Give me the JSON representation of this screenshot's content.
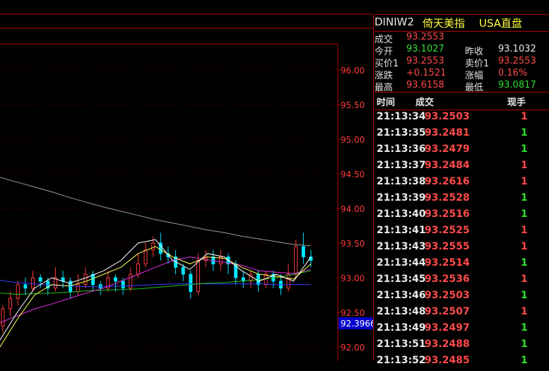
{
  "header": {
    "code": "DINIW2",
    "name": "倚天美指",
    "type": "USA直盘"
  },
  "quote": {
    "rows": [
      {
        "l1": "成交",
        "v1": "93.2553",
        "c1": "red"
      },
      {
        "l1": "今开",
        "v1": "93.1027",
        "c1": "green",
        "l2": "昨收",
        "v2": "93.1032",
        "c2": "white"
      },
      {
        "l1": "买价1",
        "v1": "93.2553",
        "c1": "red",
        "l2": "卖价1",
        "v2": "93.2553",
        "c2": "red"
      },
      {
        "l1": "涨跌",
        "v1": "+0.1521",
        "c1": "red",
        "l2": "涨幅",
        "v2": "0.16%",
        "c2": "red"
      },
      {
        "l1": "最高",
        "v1": "93.6158",
        "c1": "red",
        "l2": "最低",
        "v2": "93.0817",
        "c2": "green"
      }
    ]
  },
  "ticks": {
    "col_time": "时间",
    "col_price": "成交",
    "col_vol": "现手",
    "rows": [
      {
        "time": "21:13:34",
        "price": "93.2503",
        "vol": "1",
        "vc": "red"
      },
      {
        "time": "21:13:35",
        "price": "93.2481",
        "vol": "1",
        "vc": "green"
      },
      {
        "time": "21:13:36",
        "price": "93.2479",
        "vol": "1",
        "vc": "green"
      },
      {
        "time": "21:13:37",
        "price": "93.2484",
        "vol": "1",
        "vc": "red"
      },
      {
        "time": "21:13:38",
        "price": "93.2616",
        "vol": "1",
        "vc": "red"
      },
      {
        "time": "21:13:39",
        "price": "93.2528",
        "vol": "1",
        "vc": "green"
      },
      {
        "time": "21:13:40",
        "price": "93.2516",
        "vol": "1",
        "vc": "green"
      },
      {
        "time": "21:13:41",
        "price": "93.2525",
        "vol": "1",
        "vc": "red"
      },
      {
        "time": "21:13:43",
        "price": "93.2555",
        "vol": "1",
        "vc": "red"
      },
      {
        "time": "21:13:44",
        "price": "93.2514",
        "vol": "1",
        "vc": "green"
      },
      {
        "time": "21:13:45",
        "price": "93.2536",
        "vol": "1",
        "vc": "red"
      },
      {
        "time": "21:13:46",
        "price": "93.2503",
        "vol": "1",
        "vc": "green"
      },
      {
        "time": "21:13:48",
        "price": "93.2507",
        "vol": "1",
        "vc": "red"
      },
      {
        "time": "21:13:49",
        "price": "93.2497",
        "vol": "1",
        "vc": "green"
      },
      {
        "time": "21:13:51",
        "price": "93.2488",
        "vol": "1",
        "vc": "green"
      },
      {
        "time": "21:13:52",
        "price": "93.2485",
        "vol": "1",
        "vc": "green"
      }
    ]
  },
  "chart_data": {
    "type": "line",
    "y_ticks": [
      "96.00",
      "95.50",
      "95.00",
      "94.50",
      "94.00",
      "93.50",
      "93.00",
      "92.50",
      "92.00"
    ],
    "ylim": [
      92.0,
      96.0
    ],
    "current_price_label": "92.3966",
    "series": [
      {
        "values": [
          94.45,
          94.38,
          94.31,
          94.24,
          94.16,
          94.09,
          94.02,
          93.96,
          93.9,
          93.84,
          93.79,
          93.74,
          93.69,
          93.65,
          93.6,
          93.56,
          93.52,
          93.48,
          93.46
        ],
        "color": "#9a9a9a"
      },
      {
        "values": [
          92.96,
          92.93,
          92.91,
          92.89,
          92.88,
          92.87,
          92.87,
          92.88,
          92.89,
          92.9,
          92.91,
          92.91,
          92.91,
          92.91,
          92.91,
          92.91,
          92.9,
          92.9,
          92.9
        ],
        "color": "#3a3aff"
      },
      {
        "values": [
          92.78,
          92.76,
          92.77,
          92.78,
          92.79,
          92.81,
          92.82,
          92.83,
          92.84,
          92.86,
          92.88,
          92.9,
          92.92,
          92.93,
          92.95,
          92.97,
          93.0,
          93.05,
          93.1
        ],
        "color": "#20c020"
      },
      {
        "values": [
          92.35,
          92.45,
          92.55,
          92.62,
          92.7,
          92.78,
          92.85,
          92.95,
          93.05,
          93.15,
          93.25,
          93.3,
          93.26,
          93.22,
          93.18,
          93.1,
          93.08,
          93.06,
          93.12
        ],
        "color": "#e030e0"
      },
      {
        "values": [
          92.0,
          92.4,
          92.75,
          92.9,
          92.88,
          92.95,
          93.05,
          93.15,
          93.35,
          93.45,
          93.3,
          93.2,
          93.3,
          93.28,
          93.15,
          93.05,
          93.02,
          92.98,
          93.2
        ],
        "color": "#ffff55"
      },
      {
        "values": [
          92.1,
          92.5,
          92.85,
          93.0,
          92.92,
          93.0,
          93.1,
          93.25,
          93.5,
          93.55,
          93.25,
          93.12,
          93.35,
          93.3,
          93.1,
          92.95,
          93.05,
          92.95,
          93.3
        ],
        "color": "#ffffff"
      }
    ],
    "candles": [
      [
        92.3,
        92.55,
        92.2,
        92.6
      ],
      [
        92.55,
        92.7,
        92.45,
        92.8
      ],
      [
        92.7,
        92.9,
        92.6,
        92.95
      ],
      [
        92.9,
        92.85,
        92.75,
        93.0
      ],
      [
        92.85,
        93.0,
        92.8,
        93.1
      ],
      [
        93.0,
        92.95,
        92.85,
        93.05
      ],
      [
        92.95,
        92.85,
        92.75,
        93.0
      ],
      [
        92.85,
        93.0,
        92.8,
        93.15
      ],
      [
        93.0,
        92.95,
        92.85,
        93.1
      ],
      [
        92.95,
        92.8,
        92.7,
        93.0
      ],
      [
        92.8,
        92.9,
        92.75,
        93.05
      ],
      [
        92.9,
        93.05,
        92.85,
        93.15
      ],
      [
        93.05,
        92.9,
        92.8,
        93.1
      ],
      [
        92.9,
        92.85,
        92.75,
        92.95
      ],
      [
        92.85,
        93.0,
        92.8,
        93.1
      ],
      [
        93.0,
        92.95,
        92.8,
        93.05
      ],
      [
        92.95,
        92.85,
        92.75,
        93.0
      ],
      [
        92.85,
        93.05,
        92.8,
        93.15
      ],
      [
        93.05,
        93.2,
        93.0,
        93.35
      ],
      [
        93.2,
        93.4,
        93.15,
        93.5
      ],
      [
        93.4,
        93.5,
        93.3,
        93.6
      ],
      [
        93.5,
        93.35,
        93.25,
        93.65
      ],
      [
        93.35,
        93.3,
        93.2,
        93.45
      ],
      [
        93.3,
        93.15,
        93.05,
        93.4
      ],
      [
        93.15,
        93.05,
        92.95,
        93.2
      ],
      [
        93.05,
        92.8,
        92.7,
        93.1
      ],
      [
        92.8,
        93.25,
        92.75,
        93.35
      ],
      [
        93.25,
        93.3,
        93.15,
        93.4
      ],
      [
        93.3,
        93.2,
        93.1,
        93.4
      ],
      [
        93.2,
        93.3,
        93.1,
        93.4
      ],
      [
        93.3,
        93.2,
        93.05,
        93.35
      ],
      [
        93.2,
        93.0,
        92.9,
        93.25
      ],
      [
        93.0,
        92.95,
        92.85,
        93.1
      ],
      [
        92.95,
        93.05,
        92.85,
        93.1
      ],
      [
        93.05,
        92.9,
        92.8,
        93.1
      ],
      [
        92.9,
        93.05,
        92.85,
        93.1
      ],
      [
        93.05,
        92.95,
        92.85,
        93.1
      ],
      [
        92.95,
        92.85,
        92.75,
        93.05
      ],
      [
        92.85,
        93.05,
        92.8,
        93.2
      ],
      [
        93.05,
        93.45,
        93.0,
        93.55
      ],
      [
        93.45,
        93.3,
        93.2,
        93.65
      ],
      [
        93.3,
        93.25,
        93.15,
        93.4
      ]
    ]
  }
}
